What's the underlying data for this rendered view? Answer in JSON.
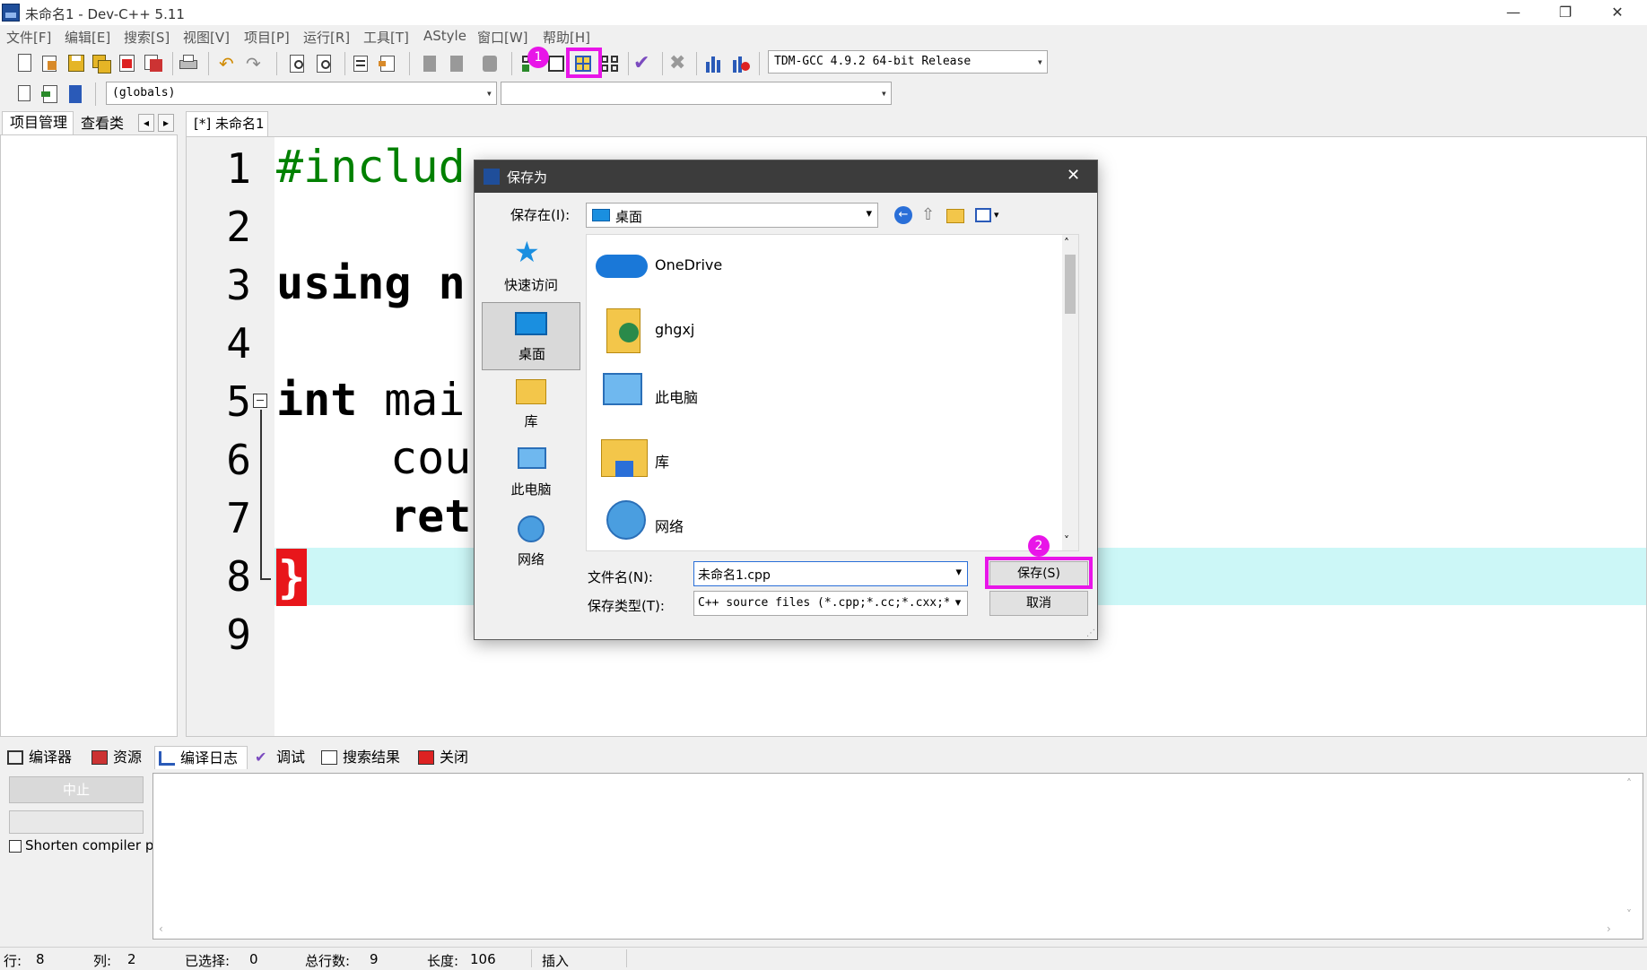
{
  "window": {
    "title": "未命名1 - Dev-C++ 5.11",
    "min": "—",
    "max": "❐",
    "close": "✕"
  },
  "menu": [
    "文件[F]",
    "编辑[E]",
    "搜索[S]",
    "视图[V]",
    "项目[P]",
    "运行[R]",
    "工具[T]",
    "AStyle",
    "窗口[W]",
    "帮助[H]"
  ],
  "toolbar": {
    "compiler_select": "TDM-GCC 4.9.2 64-bit Release",
    "scope_select": "(globals)",
    "function_select": ""
  },
  "annotations": {
    "badge1": "1",
    "badge2": "2"
  },
  "left_panel": {
    "tab_project": "项目管理",
    "tab_classes": "查看类",
    "prev": "◂",
    "next": "▸"
  },
  "editor": {
    "tab_label": "[*] 未命名1",
    "line_numbers": [
      "1",
      "2",
      "3",
      "4",
      "5",
      "6",
      "7",
      "8",
      "9"
    ],
    "lines": {
      "l1": "#includ",
      "l3": "using n",
      "l5a": "int",
      "l5b": " mai",
      "l6": "cou",
      "l7": "ret",
      "l8": "}"
    },
    "fold_marker": "⊟"
  },
  "dialog": {
    "title": "保存为",
    "close": "✕",
    "save_in_label": "保存在(I):",
    "save_in_value": "桌面",
    "places": [
      "快速访问",
      "桌面",
      "库",
      "此电脑",
      "网络"
    ],
    "files": [
      "OneDrive",
      "ghgxj",
      "此电脑",
      "库",
      "网络"
    ],
    "filename_label": "文件名(N):",
    "filename_value": "未命名1.cpp",
    "filetype_label": "保存类型(T):",
    "filetype_value": "C++ source files (*.cpp;*.cc;*.cxx;*.",
    "save_button": "保存(S)",
    "cancel_button": "取消"
  },
  "bottom": {
    "tabs": [
      "编译器",
      "资源",
      "编译日志",
      "调试",
      "搜索结果",
      "关闭"
    ],
    "abort_button": "中止",
    "shorten_label": "Shorten compiler pa"
  },
  "status": {
    "row_label": "行:",
    "row_value": "8",
    "col_label": "列:",
    "col_value": "2",
    "sel_label": "已选择:",
    "sel_value": "0",
    "total_label": "总行数:",
    "total_value": "9",
    "len_label": "长度:",
    "len_value": "106",
    "mode": "插入"
  }
}
